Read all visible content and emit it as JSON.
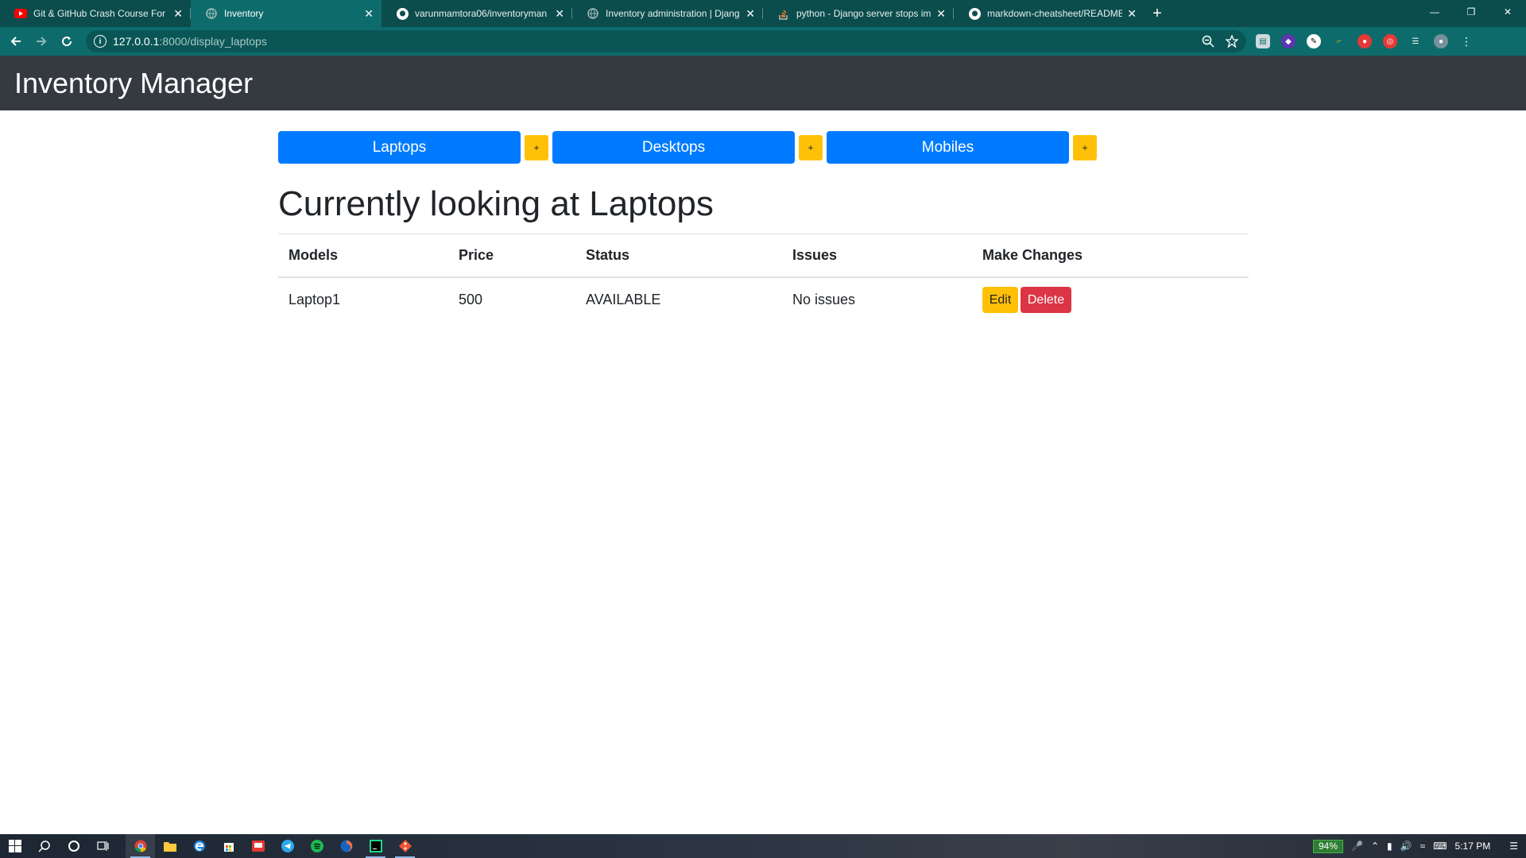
{
  "browser": {
    "tabs": [
      {
        "title": "Git & GitHub Crash Course For B",
        "favicon": "youtube-icon",
        "active": false
      },
      {
        "title": "Inventory",
        "favicon": "globe-icon",
        "active": true
      },
      {
        "title": "varunmamtora06/inventoryman",
        "favicon": "github-icon",
        "active": false
      },
      {
        "title": "Inventory administration | Djang",
        "favicon": "globe-icon",
        "active": false
      },
      {
        "title": "python - Django server stops im",
        "favicon": "stackoverflow-icon",
        "active": false
      },
      {
        "title": "markdown-cheatsheet/README.",
        "favicon": "github-icon",
        "active": false
      }
    ],
    "url_host": "127.0.0.1",
    "url_path": ":8000/display_laptops"
  },
  "navbar": {
    "brand": "Inventory Manager"
  },
  "categories": [
    {
      "label": "Laptops",
      "add_label": "+"
    },
    {
      "label": "Desktops",
      "add_label": "+"
    },
    {
      "label": "Mobiles",
      "add_label": "+"
    }
  ],
  "main": {
    "heading": "Currently looking at Laptops"
  },
  "table": {
    "headers": [
      "Models",
      "Price",
      "Status",
      "Issues",
      "Make Changes"
    ],
    "rows": [
      {
        "model": "Laptop1",
        "price": "500",
        "status": "AVAILABLE",
        "issues": "No issues",
        "edit_label": "Edit",
        "delete_label": "Delete"
      }
    ]
  },
  "taskbar": {
    "battery": "94%",
    "time": "5:17 PM"
  },
  "colors": {
    "primary": "#007bff",
    "warning": "#ffc107",
    "danger": "#dc3545",
    "navbar": "#343a40",
    "browser_frame": "#0e6b6b"
  }
}
